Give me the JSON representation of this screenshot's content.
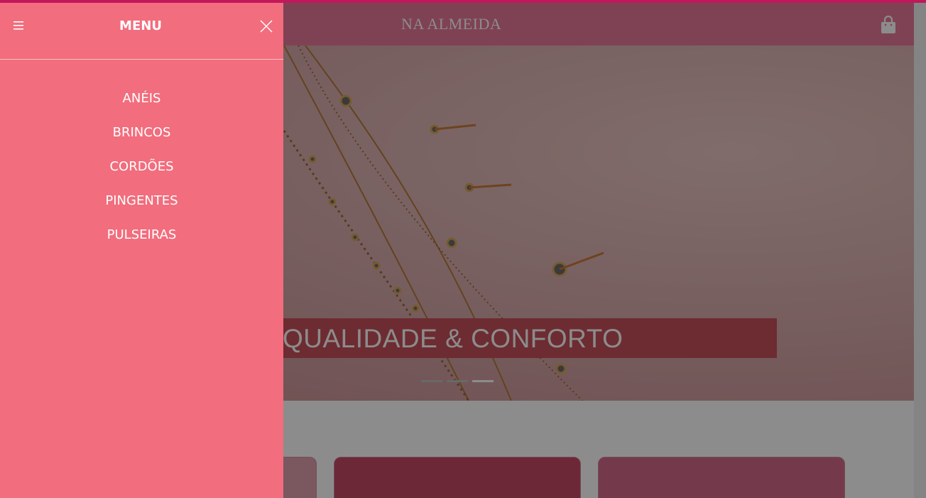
{
  "header": {
    "brand": "NA ALMEIDA",
    "cart_icon": "shopping-bag-icon"
  },
  "hero": {
    "caption": "QUALIDADE & CONFORTO",
    "slide_count": 3,
    "active_slide": 3,
    "next_icon": "chevron-right-icon"
  },
  "drawer": {
    "title": "MENU",
    "menu_icon": "hamburger-icon",
    "close_icon": "close-icon",
    "items": [
      {
        "label": "ANÉIS"
      },
      {
        "label": "BRINCOS"
      },
      {
        "label": "CORDÕES"
      },
      {
        "label": "PINGENTES"
      },
      {
        "label": "PULSEIRAS"
      }
    ]
  },
  "colors": {
    "drawer_bg": "#f26d7d",
    "header_bg": "#e8799a",
    "accent_strip": "#c2185b",
    "caption_bg": "#c7505b"
  }
}
